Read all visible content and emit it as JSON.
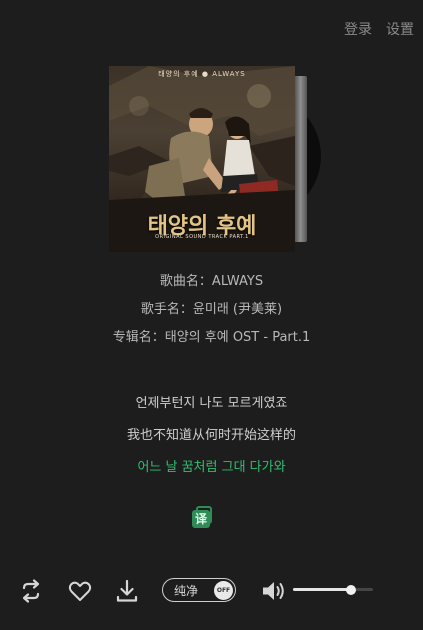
{
  "header": {
    "login_label": "登录",
    "settings_label": "设置"
  },
  "album_cover": {
    "top_text": "태양의 후예 ● ALWAYS",
    "title_art": "태양의 후예",
    "subtitle_art": "ORIGINAL SOUND TRACK  PART.1"
  },
  "song_info": {
    "title_label": "歌曲名：",
    "title": "ALWAYS",
    "artist_label": "歌手名：",
    "artist": "윤미래 (尹美莱)",
    "album_label": "专辑名：",
    "album": "태양의 후예 OST - Part.1"
  },
  "lyrics": {
    "lines": [
      "언제부턴지 나도 모르게였죠",
      "我也不知道从何时开始这样的",
      "어느 날 꿈처럼 그대 다가와"
    ],
    "active_index": 2,
    "translate_icon_char": "译"
  },
  "controls": {
    "icons": {
      "loop": "loop-icon",
      "like": "heart-icon",
      "download": "download-icon",
      "volume": "volume-icon"
    },
    "pure_mode": {
      "label": "纯净",
      "state_text": "OFF"
    },
    "volume_level": 0.73
  },
  "colors": {
    "background": "#1d1d1d",
    "accent": "#2fbf71",
    "text": "#c8c8c8",
    "muted": "#8a8a8a"
  }
}
